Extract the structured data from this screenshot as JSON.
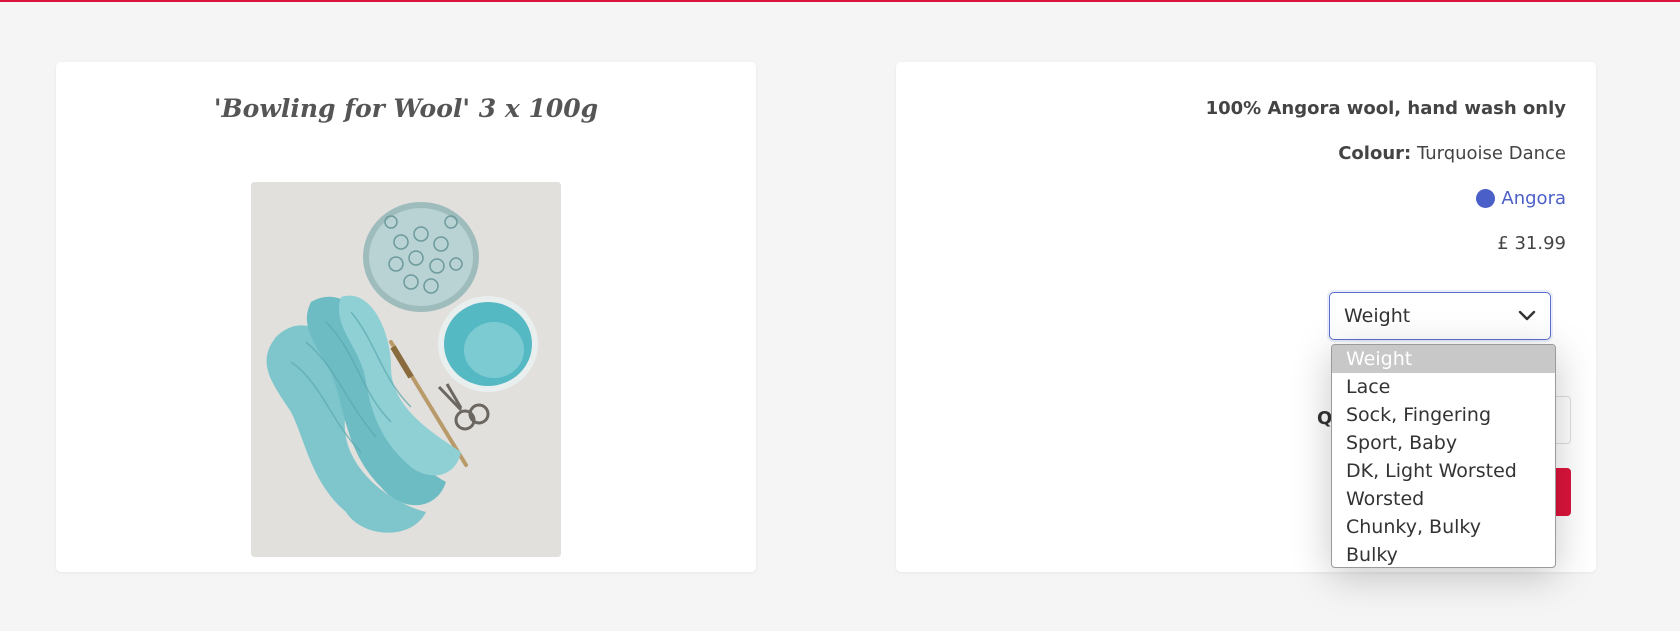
{
  "product": {
    "title": "'Bowling for Wool' 3 x 100g",
    "image_alt_icon": "yarn-product-photo"
  },
  "details": {
    "description": "100% Angora wool, hand wash only",
    "colour_label": "Colour:",
    "colour_value": "Turquoise Dance",
    "fibre": "Angora",
    "price": "£ 31.99"
  },
  "weight_select": {
    "selected": "Weight",
    "options": [
      "Weight",
      "Lace",
      "Sock, Fingering",
      "Sport, Baby",
      "DK, Light Worsted",
      "Worsted",
      "Chunky, Bulky",
      "Bulky"
    ]
  },
  "quantity": {
    "label_partial": "Q"
  },
  "colors": {
    "accent": "#dc143c",
    "fibre_blue": "#4b5fc8",
    "background": "#f5f5f5"
  }
}
